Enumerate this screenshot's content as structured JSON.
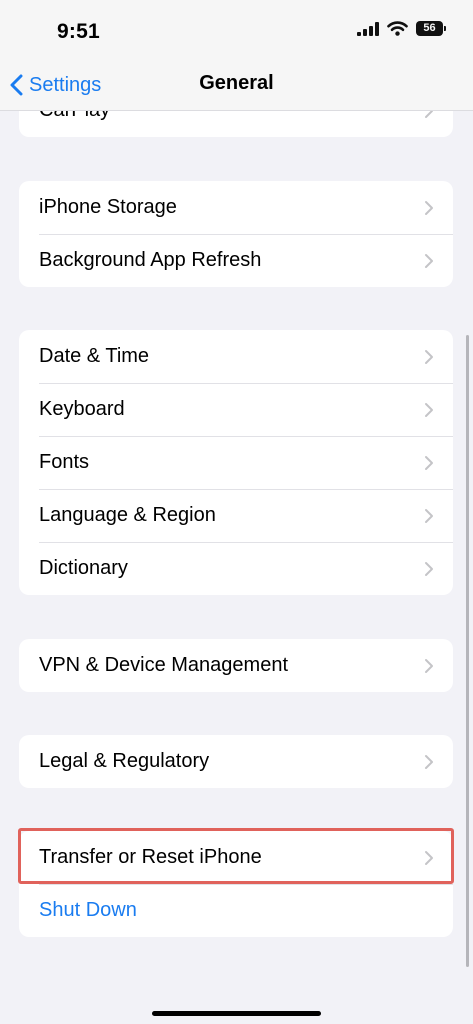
{
  "status_bar": {
    "time": "9:51",
    "battery": "56",
    "icons": [
      "cellular-signal-icon",
      "wifi-icon",
      "battery-icon"
    ]
  },
  "nav": {
    "back_label": "Settings",
    "title": "General"
  },
  "sections": [
    {
      "items": [
        {
          "label": "CarPlay"
        }
      ]
    },
    {
      "items": [
        {
          "label": "iPhone Storage"
        },
        {
          "label": "Background App Refresh"
        }
      ]
    },
    {
      "items": [
        {
          "label": "Date & Time"
        },
        {
          "label": "Keyboard"
        },
        {
          "label": "Fonts"
        },
        {
          "label": "Language & Region"
        },
        {
          "label": "Dictionary"
        }
      ]
    },
    {
      "items": [
        {
          "label": "VPN & Device Management"
        }
      ]
    },
    {
      "items": [
        {
          "label": "Legal & Regulatory"
        }
      ]
    },
    {
      "items": [
        {
          "label": "Transfer or Reset iPhone",
          "highlighted": true
        },
        {
          "label": "Shut Down"
        }
      ]
    }
  ],
  "colors": {
    "accent": "#1a7cf0",
    "background": "#f2f2f7",
    "highlight": "#e0625b",
    "chevron": "#c4c4c7"
  }
}
